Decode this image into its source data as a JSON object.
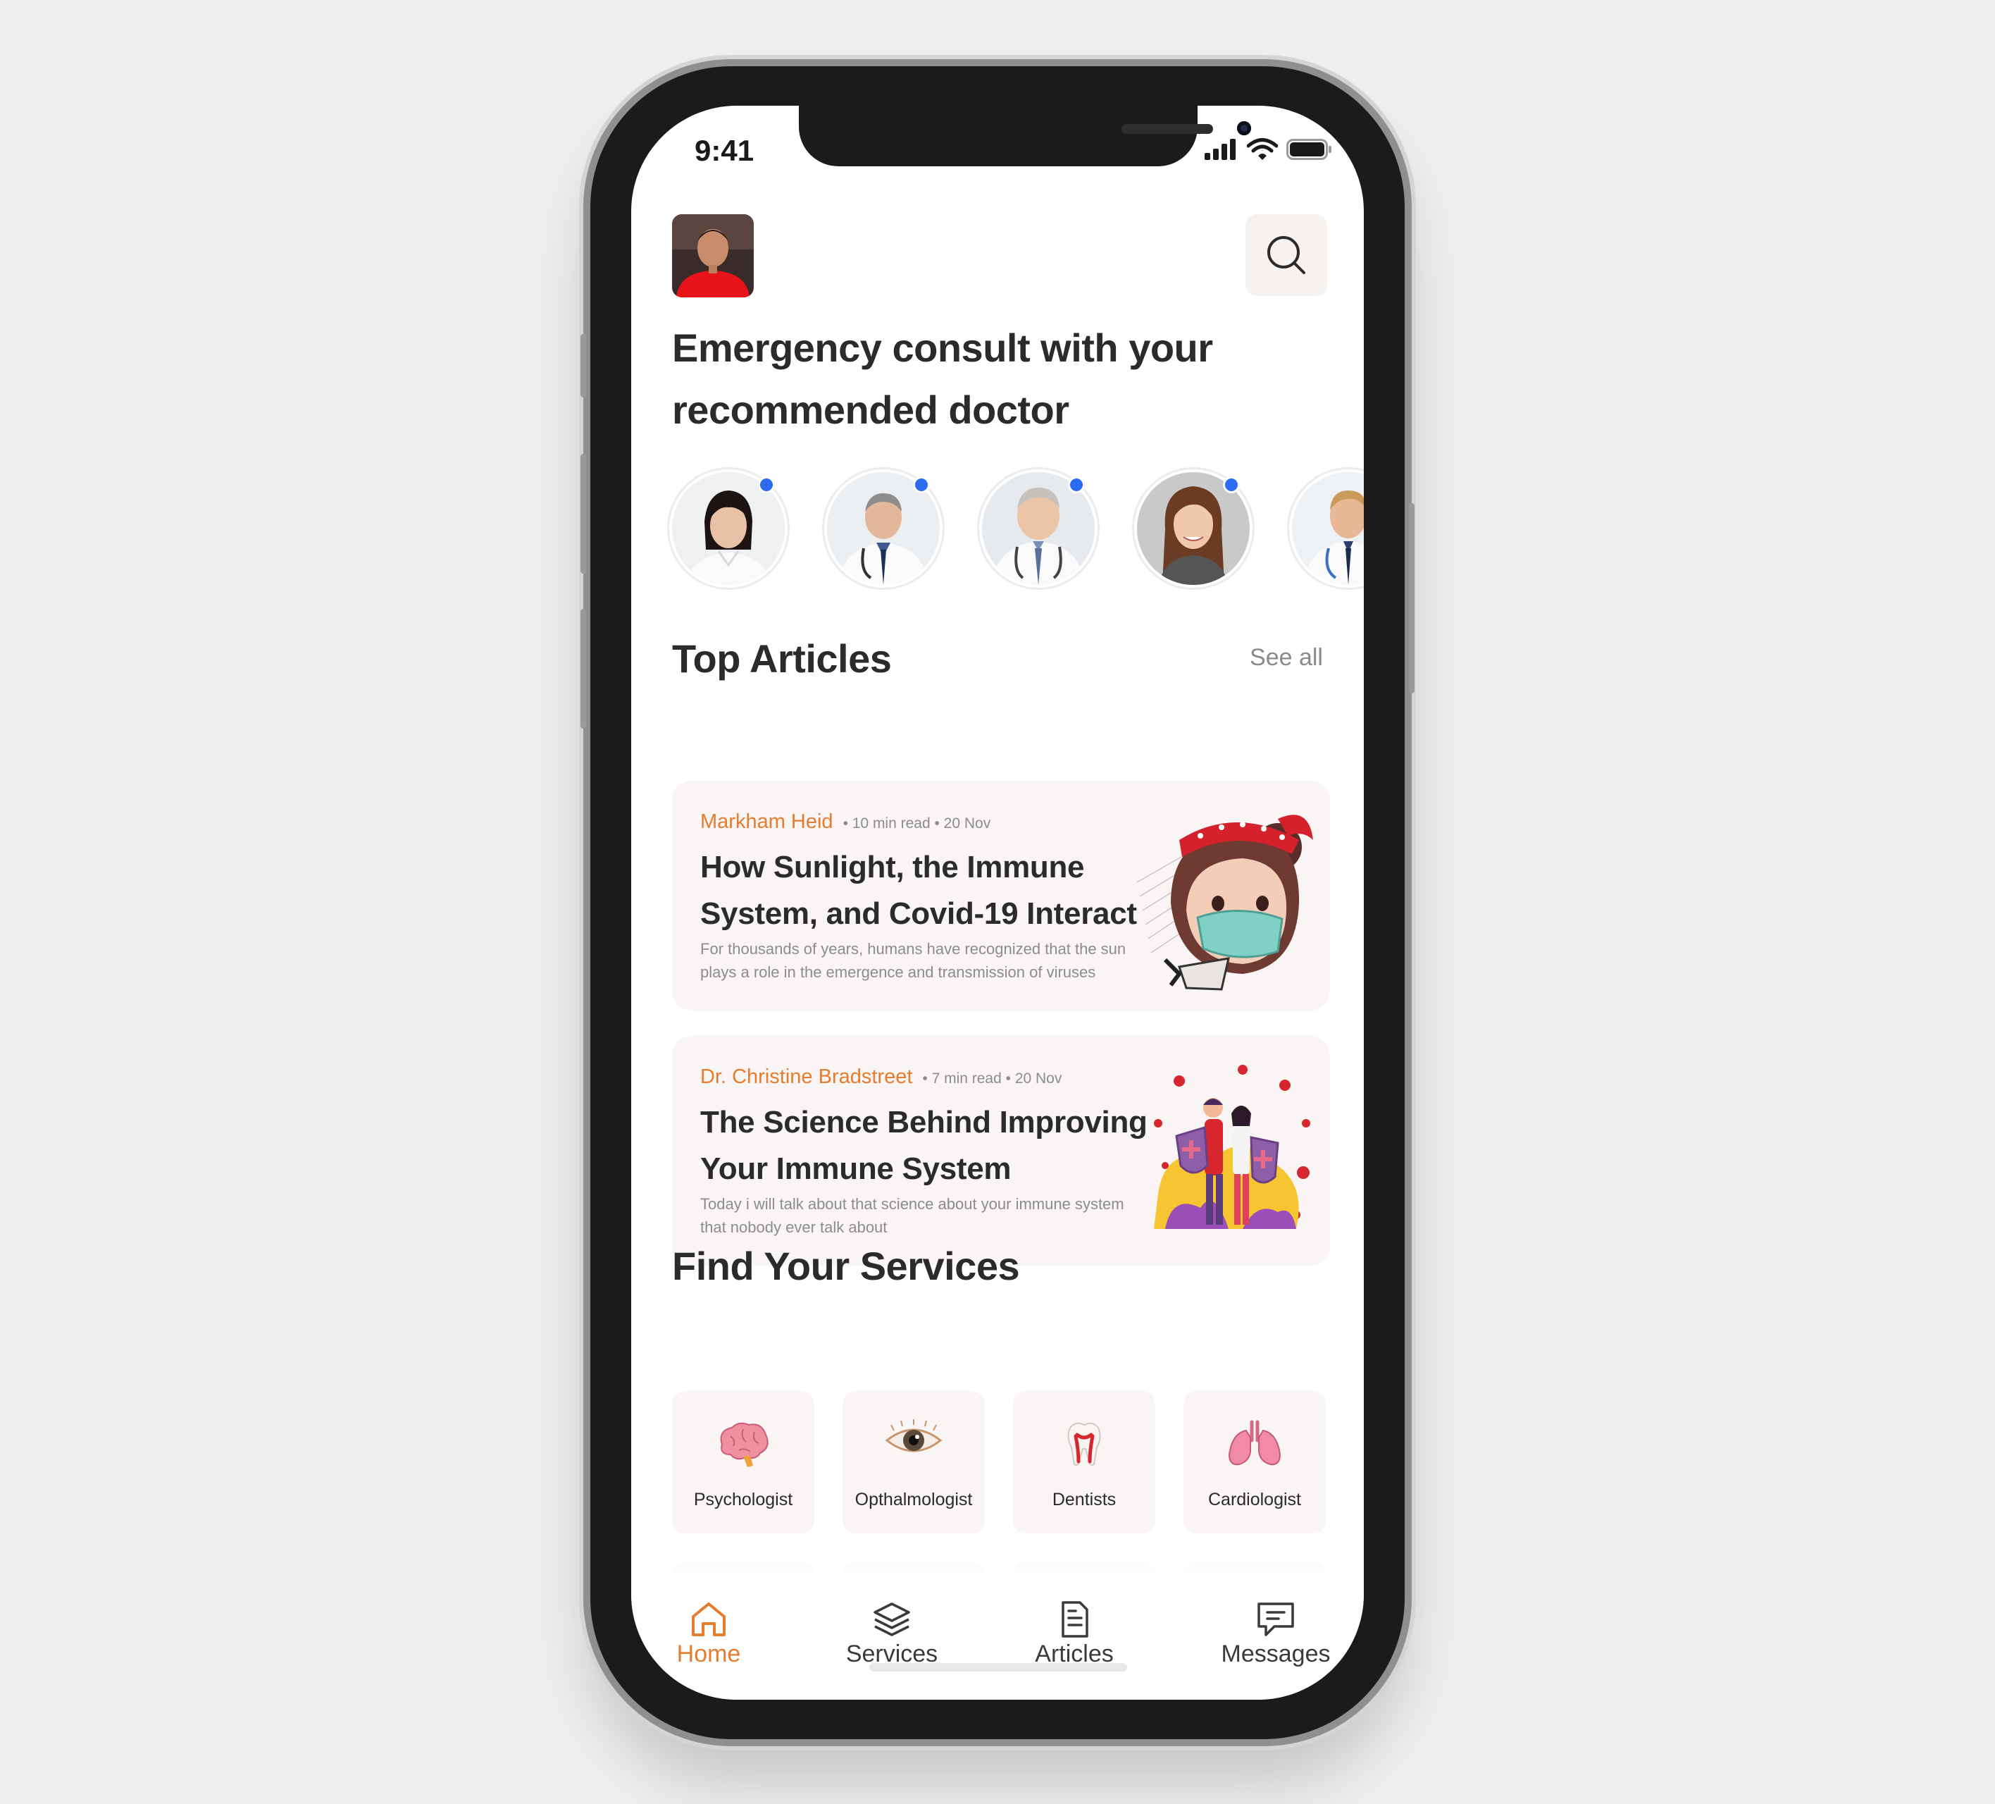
{
  "status_bar": {
    "time": "9:41"
  },
  "header": {
    "headline": "Emergency consult with your recommended doctor"
  },
  "doctors": [
    {
      "name": "doctor-1",
      "online": true
    },
    {
      "name": "doctor-2",
      "online": true
    },
    {
      "name": "doctor-3",
      "online": true
    },
    {
      "name": "doctor-4",
      "online": true
    },
    {
      "name": "doctor-5",
      "online": false
    }
  ],
  "articles_section": {
    "title": "Top Articles",
    "see_all": "See all"
  },
  "articles": [
    {
      "author": "Markham Heid",
      "read_info": "• 10 min read • 20 Nov",
      "title": "How Sunlight, the Immune System, and Covid-19 Interact",
      "description": "For thousands of years, humans have recognized that the sun plays a role in the emergence and transmission of viruses"
    },
    {
      "author": "Dr. Christine Bradstreet",
      "read_info": "• 7 min read • 20 Nov",
      "title": "The Science Behind Improving Your Immune System",
      "description": "Today i will talk about that science about your immune system that nobody ever talk about"
    }
  ],
  "services_section": {
    "title": "Find Your Services"
  },
  "services": [
    {
      "label": "Psychologist",
      "icon": "brain-icon"
    },
    {
      "label": "Opthalmologist",
      "icon": "eye-icon"
    },
    {
      "label": "Dentists",
      "icon": "tooth-icon"
    },
    {
      "label": "Cardiologist",
      "icon": "lungs-icon"
    }
  ],
  "tabbar": {
    "home": "Home",
    "services": "Services",
    "articles": "Articles",
    "messages": "Messages"
  },
  "colors": {
    "accent": "#e57c2e",
    "online_dot": "#2d6cf0",
    "card_bg": "#f8f5f4"
  }
}
